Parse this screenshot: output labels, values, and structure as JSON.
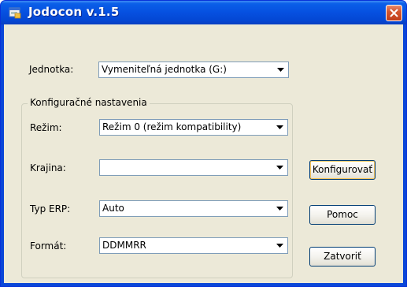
{
  "window": {
    "title": "Jodocon v.1.5",
    "icon": "app-window-icon",
    "close_icon": "close-icon"
  },
  "unit": {
    "label": "Jednotka:",
    "value": "Vymeniteľná jednotka (G:)"
  },
  "config_group": {
    "title": "Konfiguračné nastavenia",
    "mode": {
      "label": "Režim:",
      "value": "Režim 0 (režim kompatibility)"
    },
    "country": {
      "label": "Krajina:",
      "value": ""
    },
    "erp_type": {
      "label": "Typ ERP:",
      "value": "Auto"
    },
    "format": {
      "label": "Formát:",
      "value": "DDMMRR"
    }
  },
  "buttons": {
    "configure": "Konfigurovať",
    "help": "Pomoc",
    "close": "Zatvoriť"
  },
  "colors": {
    "title_bar": "#0650e0",
    "client_bg": "#ece9d8",
    "close_button": "#d4562f",
    "combo_border": "#7f9db9"
  }
}
